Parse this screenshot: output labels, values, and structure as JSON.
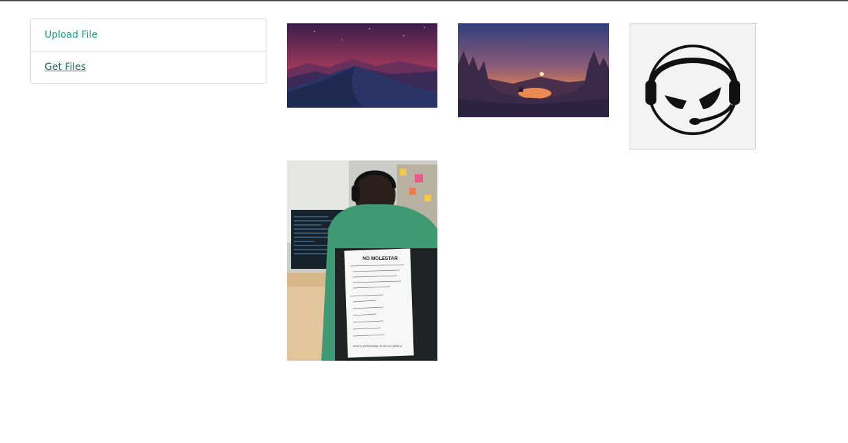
{
  "menu": {
    "upload_label": "Upload File",
    "get_label": "Get Files"
  },
  "gallery": {
    "images": [
      {
        "name": "desert-night-landscape",
        "alt": "Desert dunes at dusk"
      },
      {
        "name": "forest-sunset-landscape",
        "alt": "Forest lake at sunset"
      },
      {
        "name": "headset-gamer-logo",
        "alt": "Headset mascot logo"
      },
      {
        "name": "office-developer-photo",
        "alt": "Developer at desk with sign"
      }
    ],
    "sign": {
      "title": "NO MOLESTAR",
      "footer": "SOLO LA PROXIMA, SI NO LO VERE A"
    }
  },
  "colors": {
    "accent": "#1aaa8c",
    "link": "#1b6a5c",
    "border": "#dcdcdc"
  }
}
